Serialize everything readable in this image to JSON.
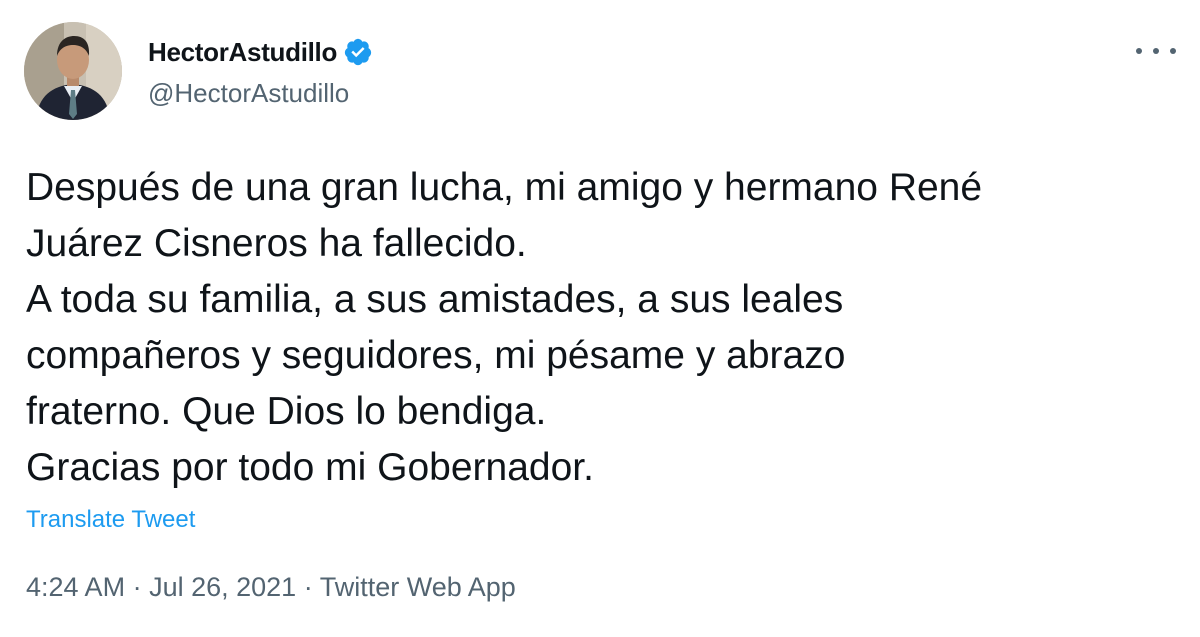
{
  "tweet": {
    "author": {
      "display_name": "HectorAstudillo",
      "handle": "@HectorAstudillo",
      "verified": true,
      "avatar_icon": "profile-photo"
    },
    "more_icon": "more-horizontal-icon",
    "text_lines": [
      "Después de una gran lucha, mi amigo y hermano René",
      "Juárez Cisneros ha fallecido.",
      "A toda su familia, a sus amistades, a sus leales",
      "compañeros y seguidores, mi pésame y abrazo",
      "fraterno. Que Dios lo bendiga.",
      "Gracias por todo mi Gobernador."
    ],
    "translate_label": "Translate Tweet",
    "time": "4:24 AM",
    "separator": " · ",
    "date": "Jul 26, 2021",
    "source": "Twitter Web App"
  },
  "colors": {
    "text_primary": "#0f1419",
    "text_secondary": "#536471",
    "accent": "#1d9bf0"
  }
}
